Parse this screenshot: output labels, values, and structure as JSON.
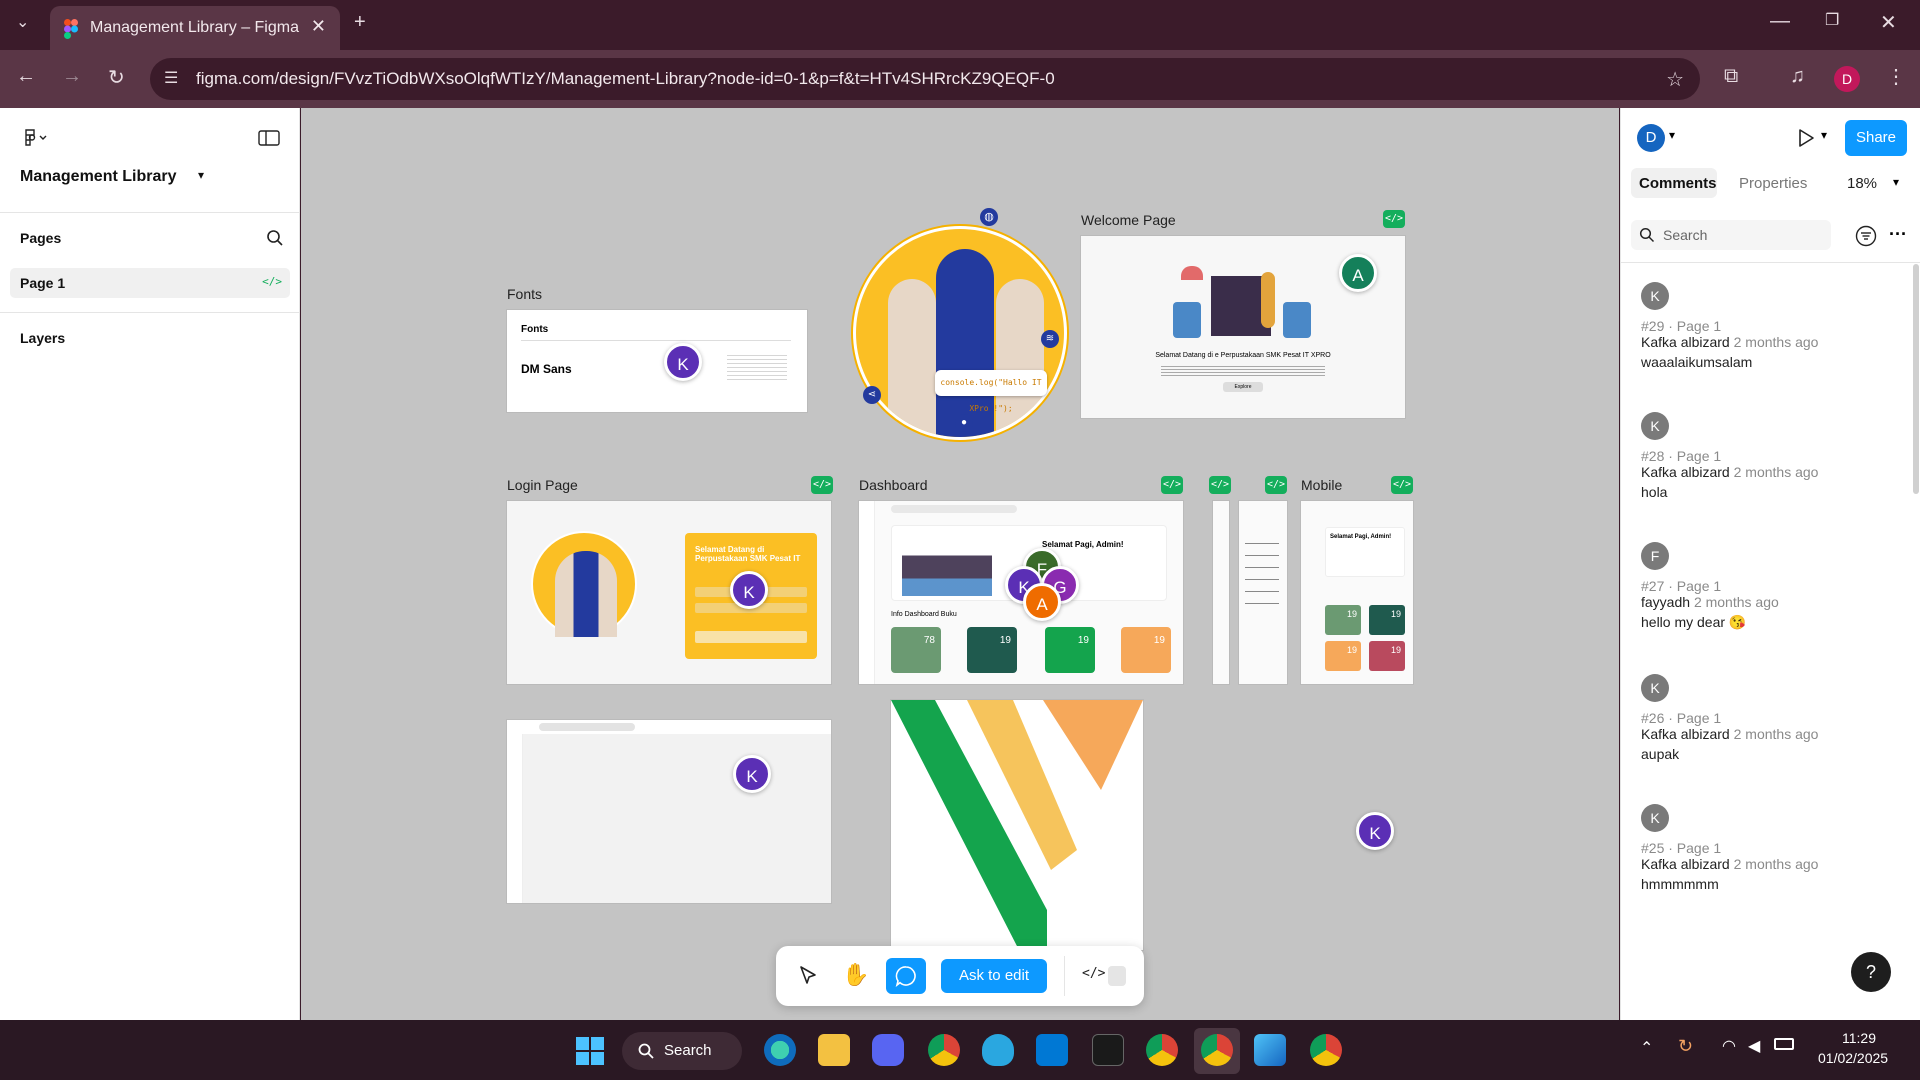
{
  "browser": {
    "tab_title": "Management Library – Figma",
    "url": "figma.com/design/FVvzTiOdbWXsoOlqfWTIzY/Management-Library?node-id=0-1&p=f&t=HTv4SHRrcKZ9QEQF-0",
    "profile_initial": "D"
  },
  "left_panel": {
    "file_name": "Management Library",
    "pages_label": "Pages",
    "page_item": "Page 1",
    "layers_label": "Layers"
  },
  "canvas": {
    "frames": {
      "fonts": "Fonts",
      "welcome": "Welcome Page",
      "login": "Login Page",
      "dashboard": "Dashboard",
      "mobile": "Mobile"
    },
    "fonts_frame": {
      "heading": "Fonts",
      "sample": "DM Sans"
    },
    "welcome_frame": {
      "headline": "Selamat Datang di e Perpustakaan SMK Pesat IT XPRO",
      "button": "Explore"
    },
    "hero_badge": "console.log(\"Hallo IT XPro !\");",
    "login_frame": {
      "title": "Selamat Datang di Perpustakaan SMK Pesat IT"
    },
    "dashboard_frame": {
      "greeting": "Selamat Pagi, Admin!",
      "info": "Info Dashboard Buku",
      "cards": [
        "78",
        "19",
        "19",
        "19"
      ]
    },
    "mobile_frame": {
      "greeting": "Selamat Pagi, Admin!",
      "cards": [
        "19",
        "19",
        "19",
        "19"
      ]
    },
    "cursors": {
      "k": "K",
      "a": "A",
      "f": "F",
      "g": "G"
    }
  },
  "right_panel": {
    "user_initial": "D",
    "share_label": "Share",
    "tab_comments": "Comments",
    "tab_properties": "Properties",
    "zoom": "18%",
    "search_placeholder": "Search",
    "comments": [
      {
        "initial": "K",
        "meta": "#29 · Page 1",
        "author": "Kafka albizard",
        "time": "2 months ago",
        "body": "waaalaikumsalam"
      },
      {
        "initial": "K",
        "meta": "#28 · Page 1",
        "author": "Kafka albizard",
        "time": "2 months ago",
        "body": "hola"
      },
      {
        "initial": "F",
        "meta": "#27 · Page 1",
        "author": "fayyadh",
        "time": "2 months ago",
        "body": "hello my dear 😘"
      },
      {
        "initial": "K",
        "meta": "#26 · Page 1",
        "author": "Kafka albizard",
        "time": "2 months ago",
        "body": "aupak"
      },
      {
        "initial": "K",
        "meta": "#25 · Page 1",
        "author": "Kafka albizard",
        "time": "2 months ago",
        "body": "hmmmmmm"
      }
    ],
    "help": "?"
  },
  "toolbar": {
    "ask_to_edit": "Ask to edit",
    "code_label": "</>"
  },
  "taskbar": {
    "search": "Search",
    "time": "11:29",
    "date": "01/02/2025"
  },
  "colors": {
    "figma_accent": "#0d99ff",
    "dev_green": "#14ae5c",
    "browser_bg": "#3b1b2a",
    "cursor_purple": "#5b2fb5"
  }
}
